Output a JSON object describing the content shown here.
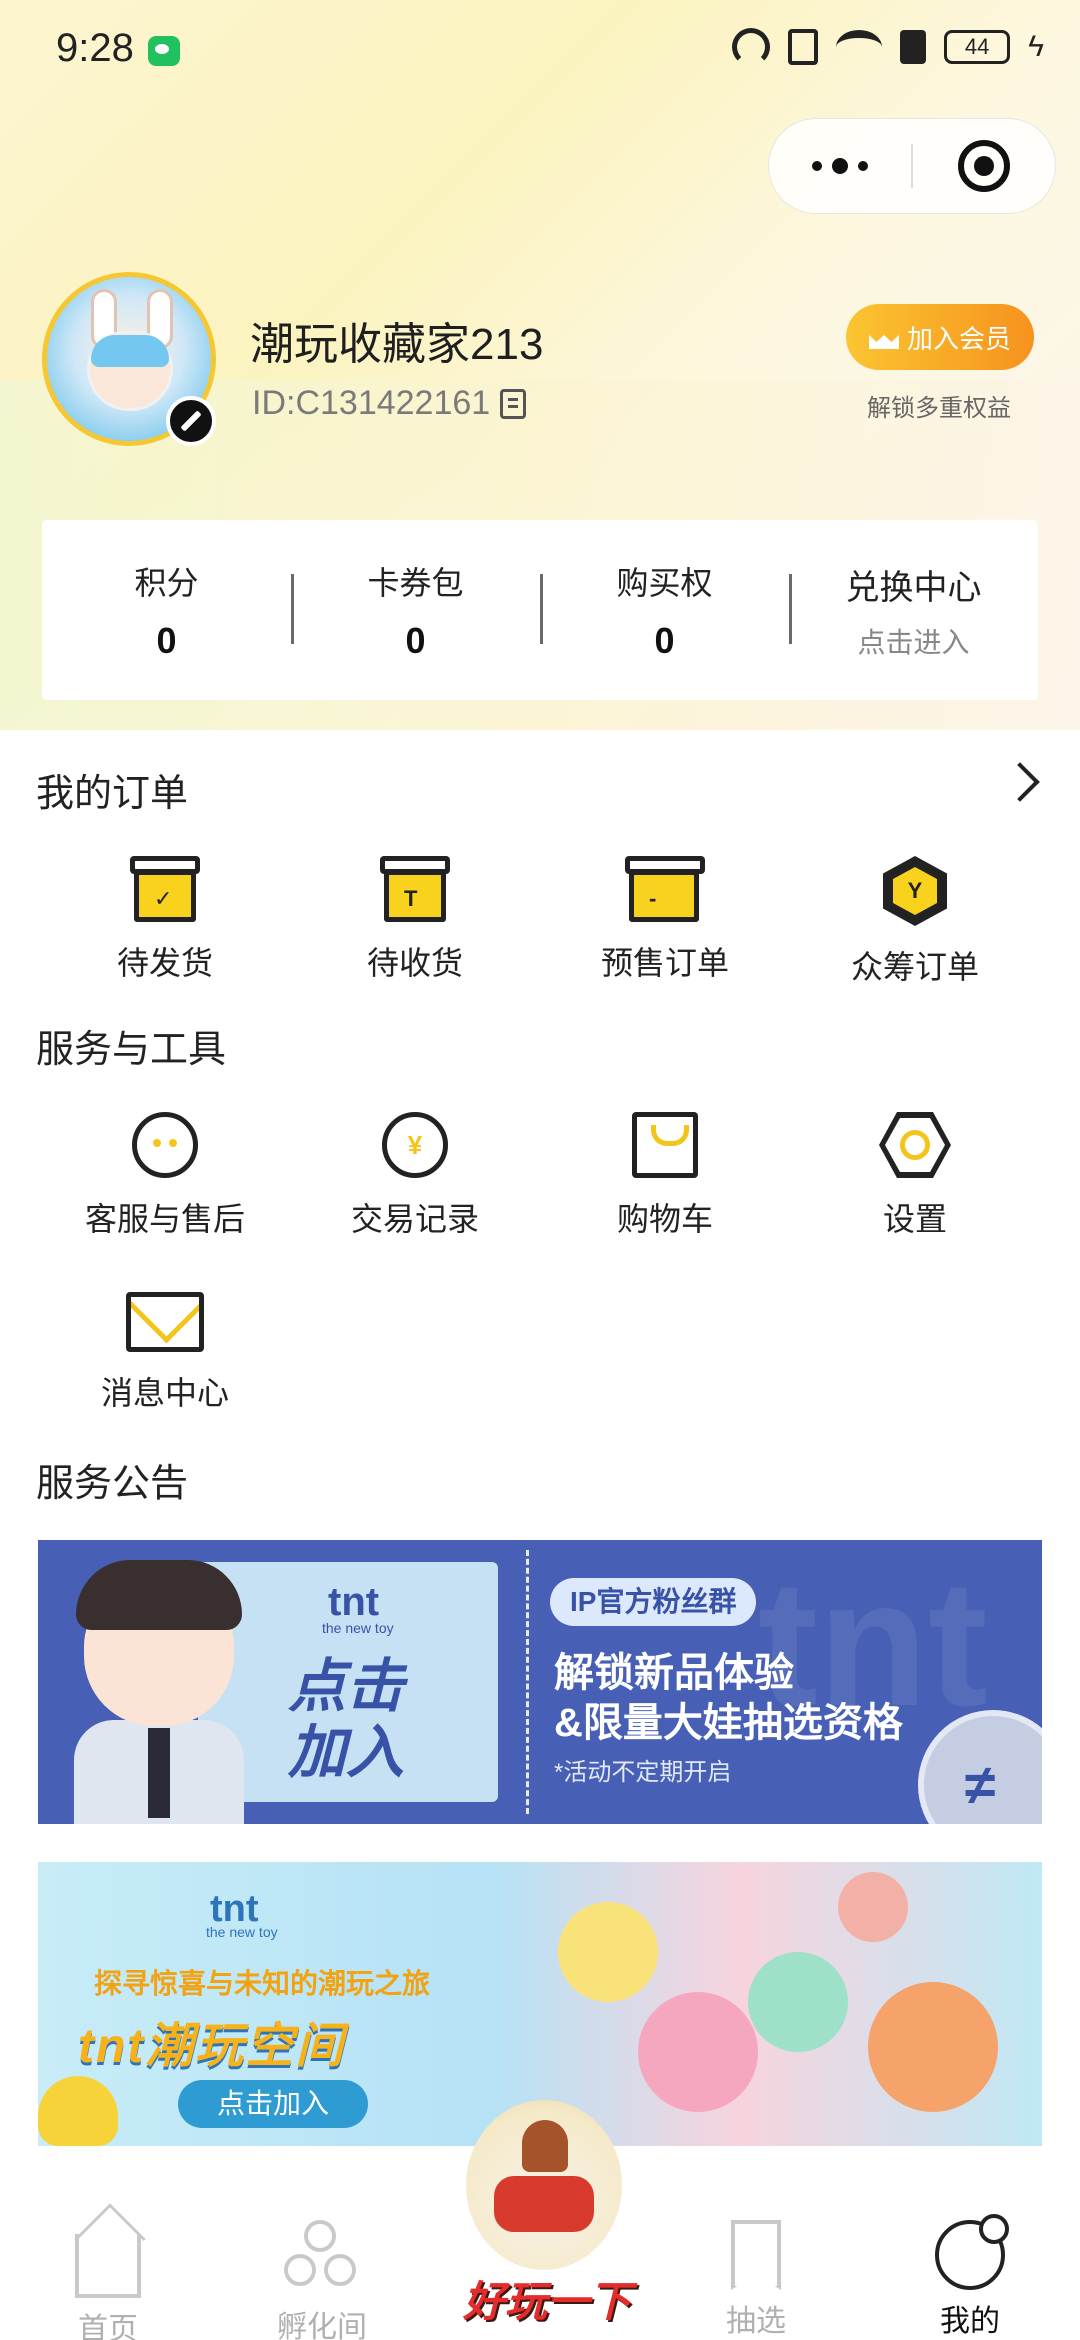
{
  "status_bar": {
    "time": "9:28",
    "battery": "44"
  },
  "profile": {
    "username": "潮玩收藏家213",
    "user_id": "ID:C131422161",
    "vip_button": "加入会员",
    "vip_subtitle": "解锁多重权益"
  },
  "stats": [
    {
      "label": "积分",
      "value": "0"
    },
    {
      "label": "卡券包",
      "value": "0"
    },
    {
      "label": "购买权",
      "value": "0"
    },
    {
      "label": "兑换中心",
      "sub": "点击进入"
    }
  ],
  "orders": {
    "title": "我的订单",
    "items": [
      {
        "label": "待发货",
        "icon": "box-check-icon"
      },
      {
        "label": "待收货",
        "icon": "box-t-icon"
      },
      {
        "label": "预售订单",
        "icon": "box-presale-icon"
      },
      {
        "label": "众筹订单",
        "icon": "crowdfund-icon"
      }
    ]
  },
  "services": {
    "title": "服务与工具",
    "items": [
      {
        "label": "客服与售后",
        "icon": "chat-icon"
      },
      {
        "label": "交易记录",
        "icon": "coin-icon"
      },
      {
        "label": "购物车",
        "icon": "bag-icon"
      },
      {
        "label": "设置",
        "icon": "gear-icon"
      },
      {
        "label": "消息中心",
        "icon": "mail-icon"
      }
    ]
  },
  "announcements": {
    "title": "服务公告",
    "banner1": {
      "brand": "tnt",
      "brand_sub": "the new toy",
      "cta_line1": "点击",
      "cta_line2": "加入",
      "tag": "IP官方粉丝群",
      "line1": "解锁新品体验",
      "line2": "&限量大娃抽选资格",
      "note": "*活动不定期开启"
    },
    "banner2": {
      "brand": "tnt",
      "brand_sub": "the new toy",
      "line1": "探寻惊喜与未知的潮玩之旅",
      "title": "tnt潮玩空间",
      "button": "点击加入"
    }
  },
  "tabbar": {
    "items": [
      {
        "label": "首页",
        "icon": "home-icon"
      },
      {
        "label": "孵化间",
        "icon": "hatch-icon"
      },
      {
        "label": "好玩一下",
        "icon": "jar-icon"
      },
      {
        "label": "抽选",
        "icon": "bookmark-icon"
      },
      {
        "label": "我的",
        "icon": "me-icon"
      }
    ],
    "active": "我的"
  }
}
